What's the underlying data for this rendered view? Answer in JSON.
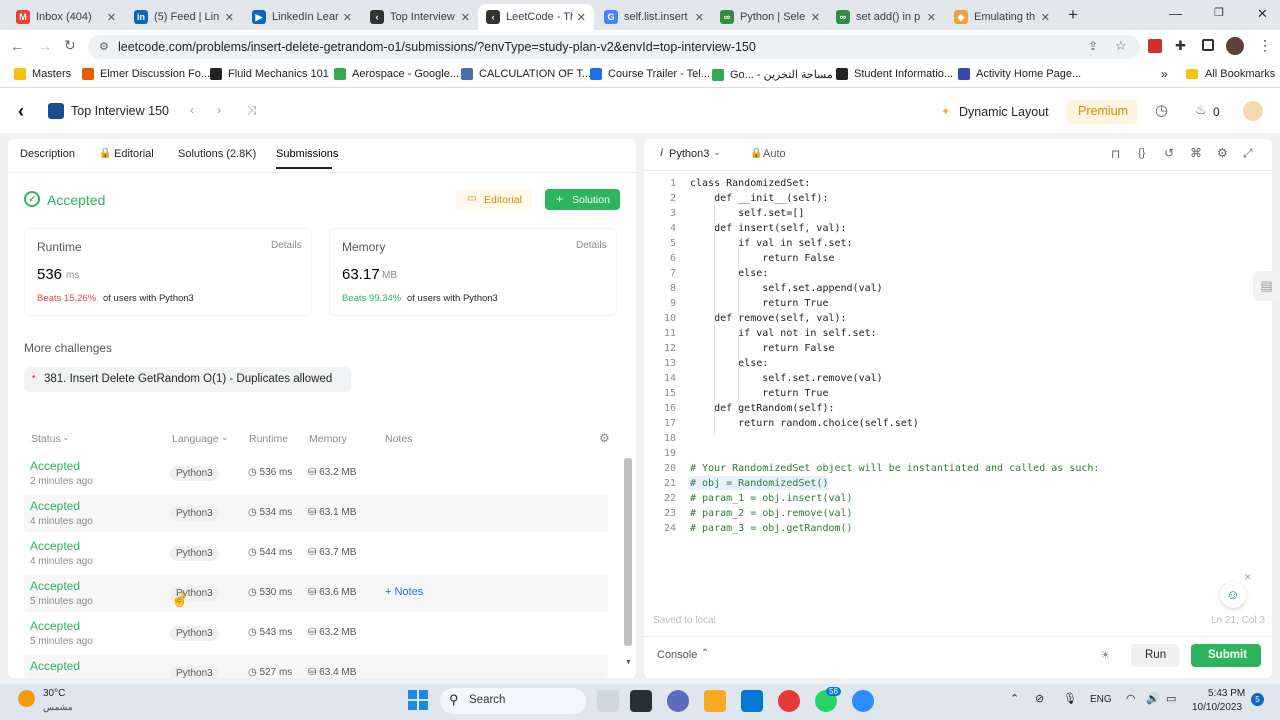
{
  "browser": {
    "tabs": [
      {
        "label": "Inbox (404)",
        "color": "#ea4335",
        "glyph": "M"
      },
      {
        "label": "(5) Feed | Lin",
        "color": "#0a66c2",
        "glyph": "in"
      },
      {
        "label": "LinkedIn Lear",
        "color": "#0a66c2",
        "glyph": "▶"
      },
      {
        "label": "Top Interview",
        "color": "#333333",
        "glyph": "‹"
      },
      {
        "label": "LeetCode - Th",
        "color": "#333333",
        "glyph": "‹"
      },
      {
        "label": "self.list.insert",
        "color": "#4285f4",
        "glyph": "G"
      },
      {
        "label": "Python | Sele",
        "color": "#2f8d46",
        "glyph": "∞"
      },
      {
        "label": "set add() in p",
        "color": "#2f8d46",
        "glyph": "∞"
      },
      {
        "label": "Emulating th",
        "color": "#e8a33d",
        "glyph": "◆"
      }
    ],
    "new_tab": "+",
    "url": "leetcode.com/problems/insert-delete-getrandom-o1/submissions/?envType=study-plan-v2&envId=top-interview-150",
    "bookmarks": [
      {
        "label": "Masters",
        "color": "#f4c20d"
      },
      {
        "label": "Elmer Discussion Fo...",
        "color": "#e65c00"
      },
      {
        "label": "Fluid Mechanics 101",
        "color": "#222222"
      },
      {
        "label": "Aerospace - Google...",
        "color": "#34a853"
      },
      {
        "label": "CALCULATION OF T...",
        "color": "#4a6fa5"
      },
      {
        "label": "Course Trailer - Tel...",
        "color": "#1a73e8"
      },
      {
        "label": "Go... - مساحة التخزين",
        "color": "#34a853"
      },
      {
        "label": "Student Informatio...",
        "color": "#222222"
      },
      {
        "label": "Activity Home Page...",
        "color": "#3949ab"
      }
    ],
    "more": "»",
    "all_bookmarks": "All Bookmarks"
  },
  "app": {
    "list_title": "Top Interview 150",
    "dynamic_layout": "Dynamic Layout",
    "premium": "Premium",
    "streak": "0"
  },
  "left": {
    "tabs": [
      "Description",
      "Editorial",
      "Solutions (2.8K)",
      "Submissions"
    ],
    "status": "Accepted",
    "editorial_btn": "Editorial",
    "solution_btn": "Solution",
    "runtime": {
      "title": "Runtime",
      "details": "Details",
      "value": "536",
      "unit": "ms",
      "beats": "Beats 15.26%",
      "suffix": "of users with Python3"
    },
    "memory": {
      "title": "Memory",
      "details": "Details",
      "value": "63.17",
      "unit": "MB",
      "beats": "Beats 99.34%",
      "suffix": "of users with Python3"
    },
    "more_challenges": "More challenges",
    "challenge": "381. Insert Delete GetRandom O(1) - Duplicates allowed",
    "columns": [
      "Status",
      "Language",
      "Runtime",
      "Memory",
      "Notes"
    ],
    "rows": [
      {
        "status": "Accepted",
        "ago": "2 minutes ago",
        "lang": "Python3",
        "runtime": "536 ms",
        "memory": "63.2 MB"
      },
      {
        "status": "Accepted",
        "ago": "4 minutes ago",
        "lang": "Python3",
        "runtime": "534 ms",
        "memory": "63.1 MB"
      },
      {
        "status": "Accepted",
        "ago": "4 minutes ago",
        "lang": "Python3",
        "runtime": "544 ms",
        "memory": "63.7 MB"
      },
      {
        "status": "Accepted",
        "ago": "5 minutes ago",
        "lang": "Python3",
        "runtime": "530 ms",
        "memory": "63.6 MB",
        "notes": "Notes"
      },
      {
        "status": "Accepted",
        "ago": "5 minutes ago",
        "lang": "Python3",
        "runtime": "543 ms",
        "memory": "63.2 MB"
      },
      {
        "status": "Accepted",
        "ago": "",
        "lang": "Python3",
        "runtime": "527 ms",
        "memory": "63.4 MB"
      }
    ]
  },
  "editor": {
    "language": "Python3",
    "mode": "Auto",
    "lines": [
      "class RandomizedSet:",
      "    def __init__(self):",
      "        self.set=[]",
      "    def insert(self, val):",
      "        if val in self.set:",
      "            return False",
      "        else:",
      "            self.set.append(val)",
      "            return True",
      "    def remove(self, val):",
      "        if val not in self.set:",
      "            return False",
      "        else:",
      "            self.set.remove(val)",
      "            return True",
      "    def getRandom(self):",
      "        return random.choice(self.set)",
      "",
      "",
      "# Your RandomizedSet object will be instantiated and called as such:",
      "# obj = RandomizedSet()",
      "# param_1 = obj.insert(val)",
      "# param_2 = obj.remove(val)",
      "# param_3 = obj.getRandom()"
    ],
    "saved": "Saved to local",
    "cursor": "Ln 21, Col 3",
    "console": "Console",
    "run": "Run",
    "submit": "Submit"
  },
  "taskbar": {
    "weather_temp": "30°C",
    "weather_desc": "مشمس",
    "search": "Search",
    "badge": "56",
    "lang": "ENG",
    "time": "5:43 PM",
    "date": "10/10/2023",
    "notif": "5"
  },
  "colors": {
    "accent_green": "#2db55d",
    "beats_red": "#ef4743",
    "premium_bg": "#fff4e0",
    "premium_text": "#d98d00"
  }
}
